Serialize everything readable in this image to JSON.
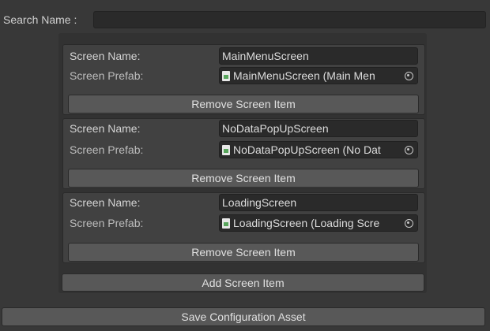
{
  "search": {
    "label": "Search Name :",
    "value": ""
  },
  "items": [
    {
      "name_label": "Screen Name:",
      "name_value": "MainMenuScreen",
      "prefab_label": "Screen Prefab:",
      "prefab_value": "MainMenuScreen (Main Men",
      "remove_label": "Remove Screen Item"
    },
    {
      "name_label": "Screen Name:",
      "name_value": "NoDataPopUpScreen",
      "prefab_label": "Screen Prefab:",
      "prefab_value": "NoDataPopUpScreen (No Dat",
      "remove_label": "Remove Screen Item"
    },
    {
      "name_label": "Screen Name:",
      "name_value": "LoadingScreen",
      "prefab_label": "Screen Prefab:",
      "prefab_value": "LoadingScreen (Loading Scre",
      "remove_label": "Remove Screen Item"
    }
  ],
  "add_label": "Add Screen Item",
  "save_label": "Save Configuration Asset",
  "icons": {
    "prefab": "prefab-file-icon",
    "picker": "object-picker-icon"
  }
}
